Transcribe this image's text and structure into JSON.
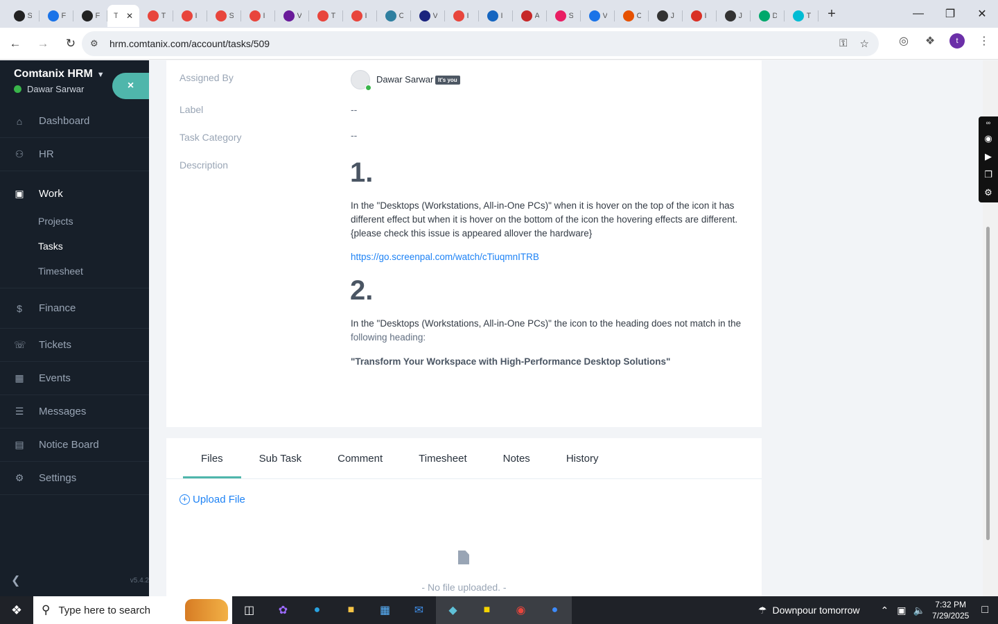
{
  "browser": {
    "url": "hrm.comtanix.com/account/tasks/509",
    "active_tab_letter": "T",
    "profile_initial": "t",
    "tabs": [
      {
        "color": "#222",
        "letter": "S"
      },
      {
        "color": "#1a73e8",
        "letter": "F"
      },
      {
        "color": "#222",
        "letter": "F"
      },
      {
        "color": "#ffffff",
        "letter": "T"
      },
      {
        "color": "#e8453c",
        "letter": "T"
      },
      {
        "color": "#e8453c",
        "letter": "I"
      },
      {
        "color": "#e8453c",
        "letter": "S"
      },
      {
        "color": "#e8453c",
        "letter": "I"
      },
      {
        "color": "#6a1b9a",
        "letter": "V"
      },
      {
        "color": "#e8453c",
        "letter": "T"
      },
      {
        "color": "#e8453c",
        "letter": "I"
      },
      {
        "color": "#2f7fa0",
        "letter": "C"
      },
      {
        "color": "#1a237e",
        "letter": "V"
      },
      {
        "color": "#e8453c",
        "letter": "I"
      },
      {
        "color": "#1565c0",
        "letter": "I"
      },
      {
        "color": "#c62828",
        "letter": "A"
      },
      {
        "color": "#e91e63",
        "letter": "S"
      },
      {
        "color": "#1a73e8",
        "letter": "V"
      },
      {
        "color": "#e65100",
        "letter": "C"
      },
      {
        "color": "#333",
        "letter": "J"
      },
      {
        "color": "#d93025",
        "letter": "I"
      },
      {
        "color": "#333",
        "letter": "J"
      },
      {
        "color": "#00a86b",
        "letter": "D"
      },
      {
        "color": "#00bcd4",
        "letter": "T"
      }
    ]
  },
  "sidebar": {
    "brand": "Comtanix HRM",
    "user": "Dawar Sarwar",
    "close_symbol": "×",
    "version": "v5.4.2",
    "items": [
      {
        "label": "Dashboard",
        "icon": "home-icon"
      },
      {
        "label": "HR",
        "icon": "users-icon"
      },
      {
        "label": "Work",
        "icon": "briefcase-icon"
      },
      {
        "label": "Finance",
        "icon": "dollar-icon"
      },
      {
        "label": "Tickets",
        "icon": "headset-icon"
      },
      {
        "label": "Events",
        "icon": "calendar-icon"
      },
      {
        "label": "Messages",
        "icon": "message-icon"
      },
      {
        "label": "Notice Board",
        "icon": "clipboard-icon"
      },
      {
        "label": "Settings",
        "icon": "gear-icon"
      }
    ],
    "work_subitems": [
      "Projects",
      "Tasks",
      "Timesheet"
    ]
  },
  "task": {
    "assigned_by_label": "Assigned By",
    "assigned_by_name": "Dawar Sarwar",
    "assigned_by_badge": "It's you",
    "label_label": "Label",
    "label_value": "--",
    "category_label": "Task Category",
    "category_value": "--",
    "description_label": "Description",
    "desc_h1": "1.",
    "desc_p1": "In the \"Desktops (Workstations, All-in-One PCs)\" when it is hover on the top of the icon it has different effect but when it is hover on the bottom of the icon the hovering effects are different. {please check this issue is appeared allover the hardware}",
    "desc_link": "https://go.screenpal.com/watch/cTiuqmnITRB",
    "desc_h2": "2.",
    "desc_p2_a": "In the \"Desktops (Workstations, All-in-One PCs)\" the icon to the heading does not match in the ",
    "desc_p2_b": "following heading:",
    "desc_quote": "\"Transform Your Workspace with High-Performance Desktop Solutions\""
  },
  "details_tabs": [
    "Files",
    "Sub Task",
    "Comment",
    "Timesheet",
    "Notes",
    "History"
  ],
  "files": {
    "upload_label": "Upload File",
    "empty_text": "- No file uploaded. -"
  },
  "taskbar": {
    "search_placeholder": "Type here to search",
    "weather": "Downpour tomorrow",
    "time": "7:32 PM",
    "date": "7/29/2025"
  }
}
